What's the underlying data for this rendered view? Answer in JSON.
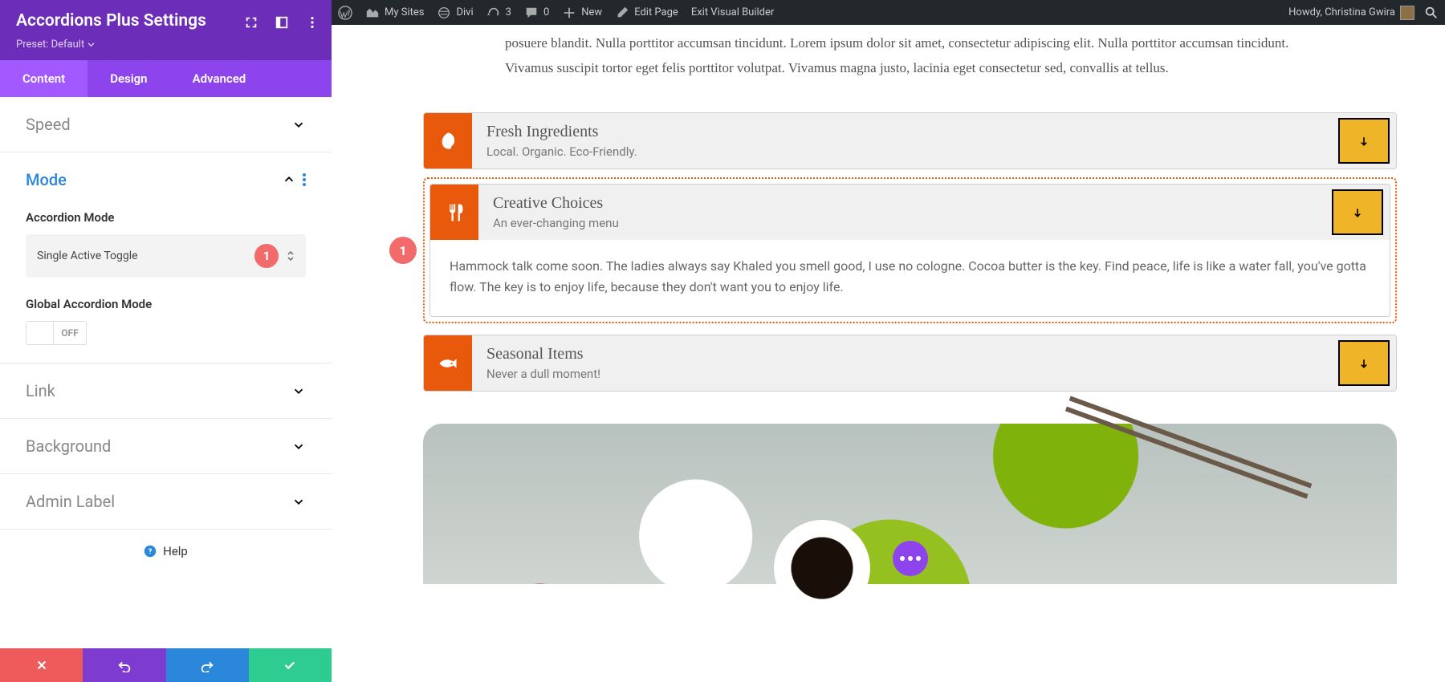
{
  "admin_bar": {
    "my_sites": "My Sites",
    "site_name": "Divi",
    "updates": "3",
    "comments": "0",
    "new": "New",
    "edit_page": "Edit Page",
    "exit_vb": "Exit Visual Builder",
    "howdy": "Howdy, Christina Gwira"
  },
  "panel": {
    "title": "Accordions Plus Settings",
    "preset": "Preset: Default",
    "tabs": {
      "content": "Content",
      "design": "Design",
      "advanced": "Advanced"
    },
    "sections": {
      "speed": "Speed",
      "mode": "Mode",
      "link": "Link",
      "background": "Background",
      "admin_label": "Admin Label"
    },
    "mode": {
      "field_label": "Accordion Mode",
      "value": "Single Active Toggle",
      "badge": "1",
      "global_label": "Global Accordion Mode",
      "toggle_state": "OFF"
    },
    "help": "Help"
  },
  "preview": {
    "intro": "posuere blandit. Nulla porttitor accumsan tincidunt. Lorem ipsum dolor sit amet, consectetur adipiscing elit. Nulla porttitor accumsan tincidunt. Vivamus suscipit tortor eget felis porttitor volutpat. Vivamus magna justo, lacinia eget consectetur sed, convallis at tellus.",
    "highlight_badge": "1",
    "items": [
      {
        "title": "Fresh Ingredients",
        "subtitle": "Local. Organic. Eco-Friendly."
      },
      {
        "title": "Creative Choices",
        "subtitle": "An ever-changing menu",
        "body": "Hammock talk come soon. The ladies always say Khaled you smell good, I use no cologne. Cocoa butter is the key. Find peace, life is like a water fall, you've gotta flow. The key is to enjoy life, because they don't want you to enjoy life."
      },
      {
        "title": "Seasonal Items",
        "subtitle": "Never a dull moment!"
      }
    ]
  }
}
